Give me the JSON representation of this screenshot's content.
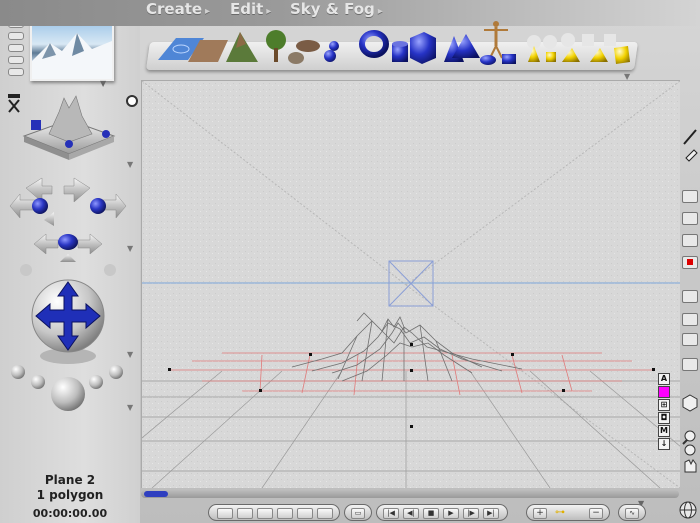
{
  "menu": {
    "items": [
      {
        "label": "Create",
        "arrow": "▸"
      },
      {
        "label": "Edit",
        "arrow": "▸"
      },
      {
        "label": "Sky & Fog",
        "arrow": "▸"
      }
    ]
  },
  "shelf": {
    "objects": [
      "water-plane",
      "terrain-flat",
      "terrain-mountain",
      "tree",
      "rock",
      "metaball",
      "torus",
      "cylinder",
      "cube",
      "cone",
      "pyramid",
      "hemisphere",
      "figure",
      "sphere",
      "square",
      "sphere-yellow",
      "cone-yellow",
      "cylinder-yellow",
      "cone-yellow-2",
      "cube-yellow"
    ]
  },
  "status": {
    "object_name": "Plane 2",
    "polygons": "1 polygon",
    "time": "00:00:00.00"
  },
  "viewport_labels": [
    "A",
    "M"
  ],
  "colors": {
    "accent_blue": "#1f2fb8",
    "grid_red": "#e07a7a",
    "horizon_blue": "#7aa3d8",
    "selection_magenta": "#ff00ff"
  },
  "bottom": {
    "transport": [
      "first-frame",
      "prev-key",
      "stop",
      "play",
      "next-key",
      "last-frame"
    ],
    "key_plus": "+",
    "key_minus": "−"
  }
}
